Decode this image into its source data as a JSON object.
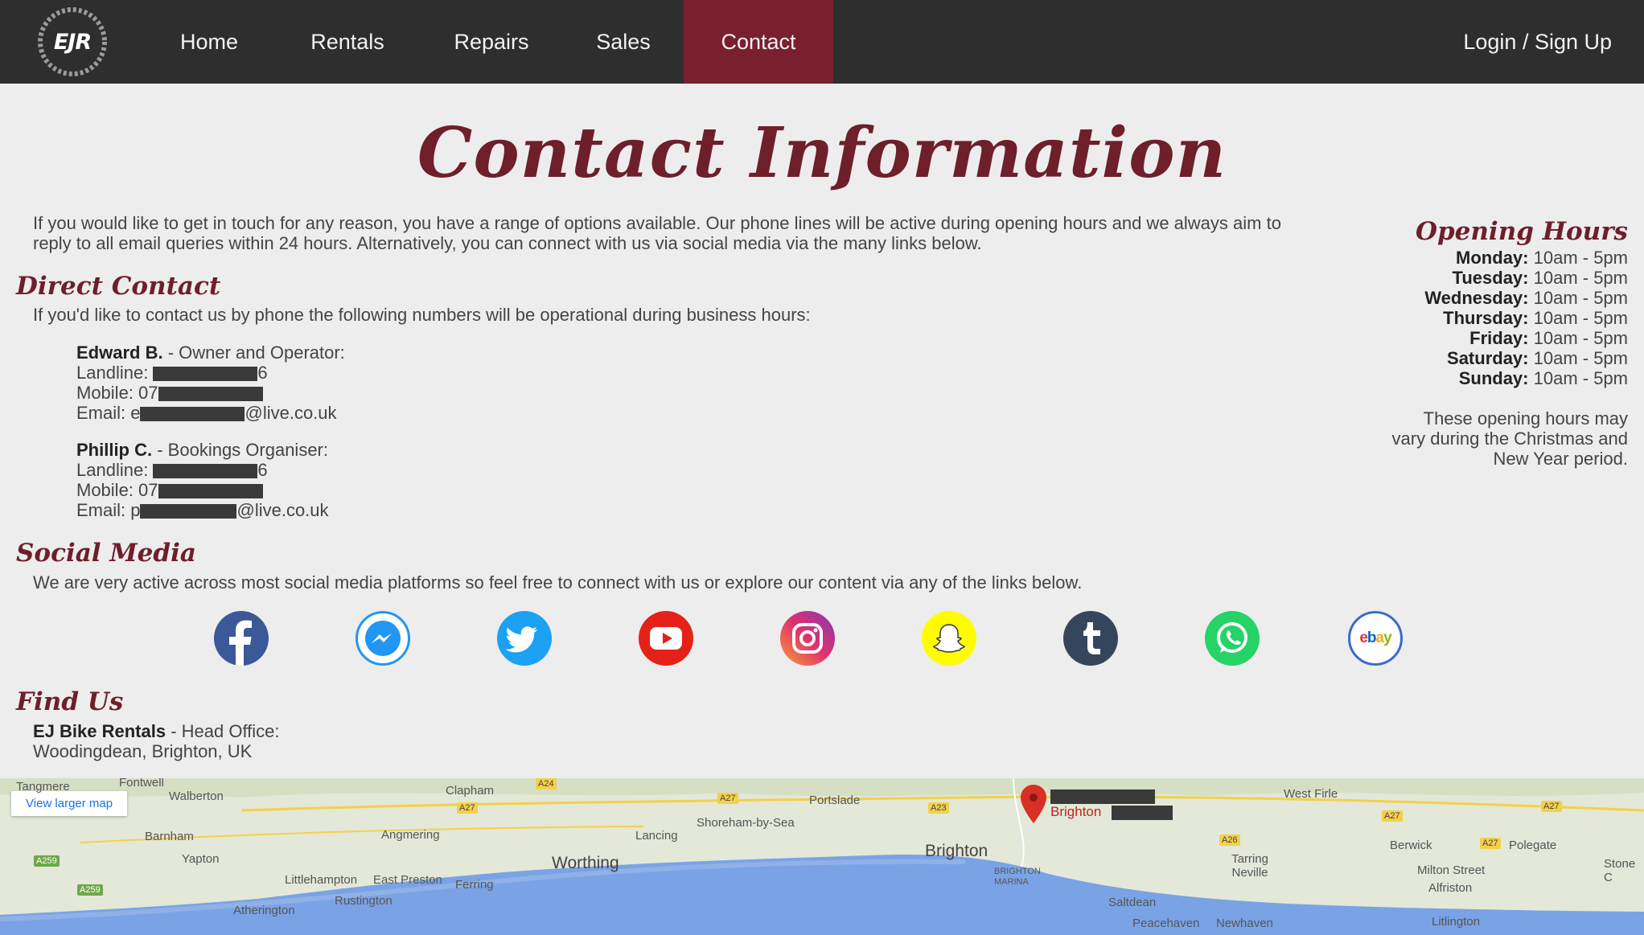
{
  "nav": {
    "logo_text": "EJR",
    "items": [
      {
        "label": "Home"
      },
      {
        "label": "Rentals"
      },
      {
        "label": "Repairs"
      },
      {
        "label": "Sales"
      },
      {
        "label": "Contact"
      }
    ],
    "active": "Contact",
    "login_label": "Login / Sign Up"
  },
  "colors": {
    "nav_bg": "#2e2e2e",
    "accent": "#7a1f2e",
    "heading": "#6e1f2a",
    "page_bg": "#ededed"
  },
  "page": {
    "title": "Contact Information",
    "intro": "If you would like to get in touch for any reason, you have a range of options available. Our phone lines will be active during opening hours and we always aim to reply to all email queries within 24 hours. Alternatively, you can connect with us via social media via the many links below."
  },
  "direct_contact": {
    "title": "Direct Contact",
    "intro": "If you'd like to contact us by phone the following numbers will be operational during business hours:",
    "contacts": [
      {
        "name": "Edward B.",
        "role": " - Owner and Operator:",
        "landline_label": "Landline: ",
        "landline_suffix": "6",
        "mobile_label": "Mobile: 07",
        "email_label": "Email: e",
        "email_suffix": "@live.co.uk"
      },
      {
        "name": "Phillip C.",
        "role": " - Bookings Organiser:",
        "landline_label": "Landline: ",
        "landline_suffix": "6",
        "mobile_label": "Mobile: 07",
        "email_label": "Email: p",
        "email_suffix": "@live.co.uk"
      }
    ]
  },
  "opening_hours": {
    "title": "Opening Hours",
    "days": [
      {
        "day": "Monday:",
        "hours": " 10am - 5pm"
      },
      {
        "day": "Tuesday:",
        "hours": " 10am - 5pm"
      },
      {
        "day": "Wednesday:",
        "hours": " 10am - 5pm"
      },
      {
        "day": "Thursday:",
        "hours": " 10am - 5pm"
      },
      {
        "day": "Friday:",
        "hours": " 10am - 5pm"
      },
      {
        "day": "Saturday:",
        "hours": " 10am - 5pm"
      },
      {
        "day": "Sunday:",
        "hours": " 10am - 5pm"
      }
    ],
    "note": "These opening hours may vary during the Christmas and New Year period."
  },
  "social": {
    "title": "Social Media",
    "intro": "We are very active across most social media platforms so feel free to connect with us or explore our content via any of the links below.",
    "icons": [
      {
        "name": "facebook-icon",
        "color": "#3b5998"
      },
      {
        "name": "messenger-icon",
        "color": "#2196f3"
      },
      {
        "name": "twitter-icon",
        "color": "#1da1f2"
      },
      {
        "name": "youtube-icon",
        "color": "#e62117"
      },
      {
        "name": "instagram-icon",
        "color": "#c13584"
      },
      {
        "name": "snapchat-icon",
        "color": "#fffc00"
      },
      {
        "name": "tumblr-icon",
        "color": "#35465c"
      },
      {
        "name": "whatsapp-icon",
        "color": "#25d366"
      },
      {
        "name": "ebay-icon",
        "color": "#ffffff"
      }
    ],
    "ebay_text": "ebay"
  },
  "find_us": {
    "title": "Find Us",
    "name": "EJ Bike Rentals",
    "role": " - Head Office:",
    "address": "Woodingdean, Brighton, UK"
  },
  "map": {
    "view_larger": "View larger map",
    "pin_label": "Brighton",
    "places": [
      "Tangmere",
      "Fontwell",
      "Walberton",
      "Clapham",
      "Portslade",
      "West Firle",
      "Barnham",
      "Angmering",
      "Lancing",
      "Shoreham-by-Sea",
      "Brighton",
      "Berwick",
      "Polegate",
      "Yapton",
      "Worthing",
      "Tarring Neville",
      "Milton Street",
      "Stone C",
      "Littlehampton",
      "East Preston",
      "Ferring",
      "BRIGHTON MARINA",
      "Alfriston",
      "Rustington",
      "Saltdean",
      "Atherington",
      "Peacehaven",
      "Newhaven",
      "Litlington"
    ],
    "roads": [
      "A24",
      "A27",
      "A27",
      "A23",
      "A27",
      "A259",
      "A26",
      "A27",
      "A27",
      "A259"
    ]
  }
}
